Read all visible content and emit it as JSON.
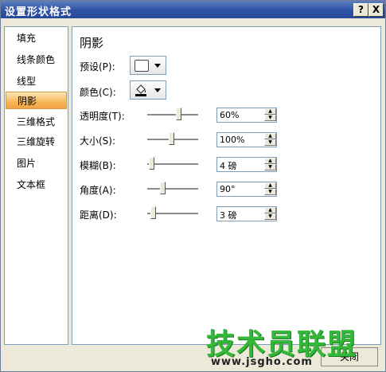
{
  "window": {
    "title": "设置形状格式",
    "help_button": "?",
    "close_button": "X"
  },
  "sidebar": {
    "items": [
      {
        "label": "填充"
      },
      {
        "label": "线条颜色"
      },
      {
        "label": "线型"
      },
      {
        "label": "阴影",
        "selected": true
      },
      {
        "label": "三维格式"
      },
      {
        "label": "三维旋转"
      },
      {
        "label": "图片"
      },
      {
        "label": "文本框"
      }
    ]
  },
  "shadow": {
    "section_title": "阴影",
    "preset_label": "预设(P):",
    "color_label": "颜色(C):",
    "color_icon": "paint-bucket-icon",
    "color_swatch": "#000000",
    "rows": [
      {
        "label": "透明度(T):",
        "value": "60%",
        "level": 0.6
      },
      {
        "label": "大小(S):",
        "value": "100%",
        "level": 0.5
      },
      {
        "label": "模糊(B):",
        "value": "4 磅",
        "level": 0.04
      },
      {
        "label": "角度(A):",
        "value": "90°",
        "level": 0.25
      },
      {
        "label": "距离(D):",
        "value": "3 磅",
        "level": 0.03
      }
    ]
  },
  "footer": {
    "close_label": "关闭"
  },
  "watermark": {
    "text": "技术员联盟",
    "url": "www.jsgho.com"
  },
  "colors": {
    "titlebar": "#2f52a6",
    "selection": "#f7b75a",
    "watermark": "#34b83a"
  }
}
